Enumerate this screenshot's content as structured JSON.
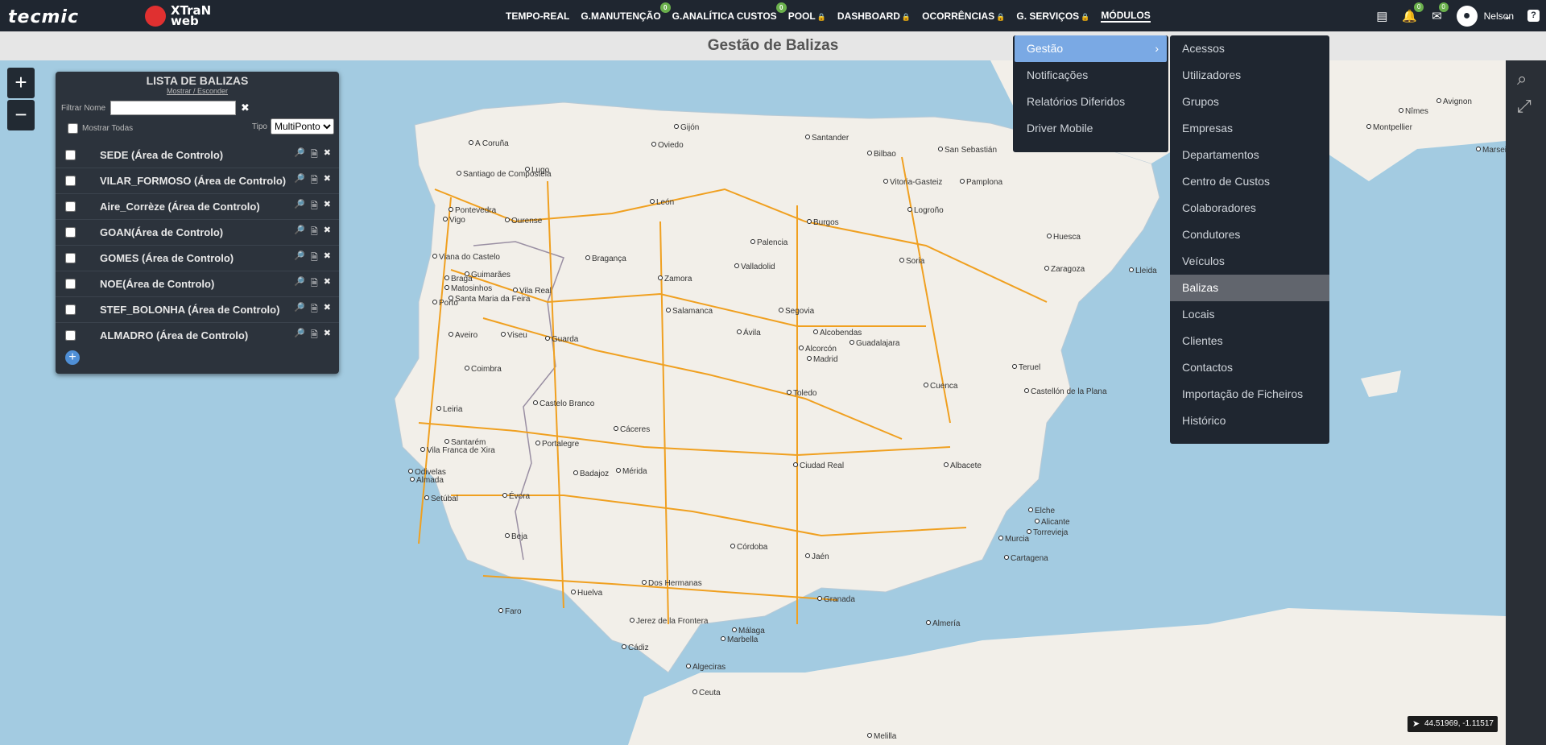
{
  "brand": {
    "logo_text": "tecmic",
    "product_line1": "XTraN",
    "product_line2": "web"
  },
  "nav": [
    {
      "label": "TEMPO-REAL"
    },
    {
      "label": "G.MANUTENÇÃO",
      "badge": "0"
    },
    {
      "label": "G.ANALÍTICA CUSTOS",
      "badge": "0"
    },
    {
      "label": "POOL",
      "lock": true
    },
    {
      "label": "DASHBOARD",
      "lock": true
    },
    {
      "label": "OCORRÊNCIAS",
      "lock": true
    },
    {
      "label": "G. SERVIÇOS",
      "lock": true
    },
    {
      "label": "MÓDULOS",
      "active": true
    }
  ],
  "header_icons": {
    "notifications_badge": "0",
    "messages_badge": "0",
    "user_name": "Nelson",
    "help": "?"
  },
  "page_title": "Gestão de Balizas",
  "panel": {
    "title": "LISTA DE BALIZAS",
    "toggle": "Mostrar / Esconder",
    "filter_label": "Filtrar Nome",
    "filter_value": "",
    "show_all": "Mostrar Todas",
    "type_label": "Tipo",
    "type_value": "MultiPonto",
    "beacons": [
      {
        "name": "SEDE (Área de Controlo)"
      },
      {
        "name": "VILAR_FORMOSO (Área de Controlo)"
      },
      {
        "name": "Aire_Corrèze (Área de Controlo)"
      },
      {
        "name": "GOAN(Área de Controlo)"
      },
      {
        "name": "GOMES (Área de Controlo)"
      },
      {
        "name": "NOE(Área de Controlo)"
      },
      {
        "name": "STEF_BOLONHA (Área de Controlo)"
      },
      {
        "name": "ALMADRO (Área de Controlo)"
      }
    ],
    "add": "+"
  },
  "menu_modulos": [
    {
      "label": "Gestão",
      "highlight": true
    },
    {
      "label": "Notificações"
    },
    {
      "label": "Relatórios Diferidos"
    },
    {
      "label": "Driver Mobile"
    }
  ],
  "menu_gestao": [
    {
      "label": "Acessos"
    },
    {
      "label": "Utilizadores"
    },
    {
      "label": "Grupos"
    },
    {
      "label": "Empresas"
    },
    {
      "label": "Departamentos"
    },
    {
      "label": "Centro de Custos"
    },
    {
      "label": "Colaboradores"
    },
    {
      "label": "Condutores"
    },
    {
      "label": "Veículos"
    },
    {
      "label": "Balizas",
      "active": true
    },
    {
      "label": "Locais"
    },
    {
      "label": "Clientes"
    },
    {
      "label": "Contactos"
    },
    {
      "label": "Importação de Ficheiros"
    },
    {
      "label": "Histórico"
    }
  ],
  "map": {
    "zoom_in": "+",
    "zoom_out": "−",
    "coords": "44.51969, -1.11517",
    "cities": [
      {
        "name": "Gijón"
      },
      {
        "name": "Oviedo"
      },
      {
        "name": "A Coruña"
      },
      {
        "name": "Santander"
      },
      {
        "name": "Bilbao"
      },
      {
        "name": "San Sebastián"
      },
      {
        "name": "Lugo"
      },
      {
        "name": "Santiago de Compostela"
      },
      {
        "name": "León"
      },
      {
        "name": "Burgos"
      },
      {
        "name": "Vitoria-Gasteiz"
      },
      {
        "name": "Pamplona"
      },
      {
        "name": "Logroño"
      },
      {
        "name": "Pontevedra"
      },
      {
        "name": "Vigo"
      },
      {
        "name": "Ourense"
      },
      {
        "name": "Palencia"
      },
      {
        "name": "Huesca"
      },
      {
        "name": "Valladolid"
      },
      {
        "name": "Soria"
      },
      {
        "name": "Zaragoza"
      },
      {
        "name": "Lleida"
      },
      {
        "name": "Viana do Castelo"
      },
      {
        "name": "Bragança"
      },
      {
        "name": "Guimarães"
      },
      {
        "name": "Braga"
      },
      {
        "name": "Zamora"
      },
      {
        "name": "Vila Real"
      },
      {
        "name": "Porto"
      },
      {
        "name": "Matosinhos"
      },
      {
        "name": "Santa Maria da Feira"
      },
      {
        "name": "Salamanca"
      },
      {
        "name": "Segovia"
      },
      {
        "name": "Viseu"
      },
      {
        "name": "Aveiro"
      },
      {
        "name": "Guarda"
      },
      {
        "name": "Ávila"
      },
      {
        "name": "Alcobendas"
      },
      {
        "name": "Alcorcón"
      },
      {
        "name": "Guadalajara"
      },
      {
        "name": "Madrid"
      },
      {
        "name": "Teruel"
      },
      {
        "name": "Coimbra"
      },
      {
        "name": "Toledo"
      },
      {
        "name": "Cuenca"
      },
      {
        "name": "Castellón de la Plana"
      },
      {
        "name": "Leiria"
      },
      {
        "name": "Castelo Branco"
      },
      {
        "name": "Cáceres"
      },
      {
        "name": "Santarém"
      },
      {
        "name": "Vila Franca de Xira"
      },
      {
        "name": "Portalegre"
      },
      {
        "name": "Ciudad Real"
      },
      {
        "name": "Albacete"
      },
      {
        "name": "Odivelas"
      },
      {
        "name": "Almada"
      },
      {
        "name": "Setúbal"
      },
      {
        "name": "Badajoz"
      },
      {
        "name": "Mérida"
      },
      {
        "name": "Évora"
      },
      {
        "name": "Elche"
      },
      {
        "name": "Alicante"
      },
      {
        "name": "Torrevieja"
      },
      {
        "name": "Beja"
      },
      {
        "name": "Córdoba"
      },
      {
        "name": "Jaén"
      },
      {
        "name": "Murcia"
      },
      {
        "name": "Cartagena"
      },
      {
        "name": "Huelva"
      },
      {
        "name": "Dos Hermanas"
      },
      {
        "name": "Granada"
      },
      {
        "name": "Almería"
      },
      {
        "name": "Faro"
      },
      {
        "name": "Jerez de la Frontera"
      },
      {
        "name": "Málaga"
      },
      {
        "name": "Marbella"
      },
      {
        "name": "Cádiz"
      },
      {
        "name": "Algeciras"
      },
      {
        "name": "Ceuta"
      },
      {
        "name": "Melilla"
      },
      {
        "name": "Nîmes"
      },
      {
        "name": "Avignon"
      },
      {
        "name": "Montpellier"
      },
      {
        "name": "Marseille"
      }
    ]
  },
  "colors": {
    "nav_bg": "#1f2630",
    "panel_bg": "#2c333c",
    "menu_highlight": "#7aa9e4",
    "active_item": "#61656d",
    "badge": "#6ab04c",
    "sea": "#a3cbe1",
    "land": "#f2efe9"
  }
}
